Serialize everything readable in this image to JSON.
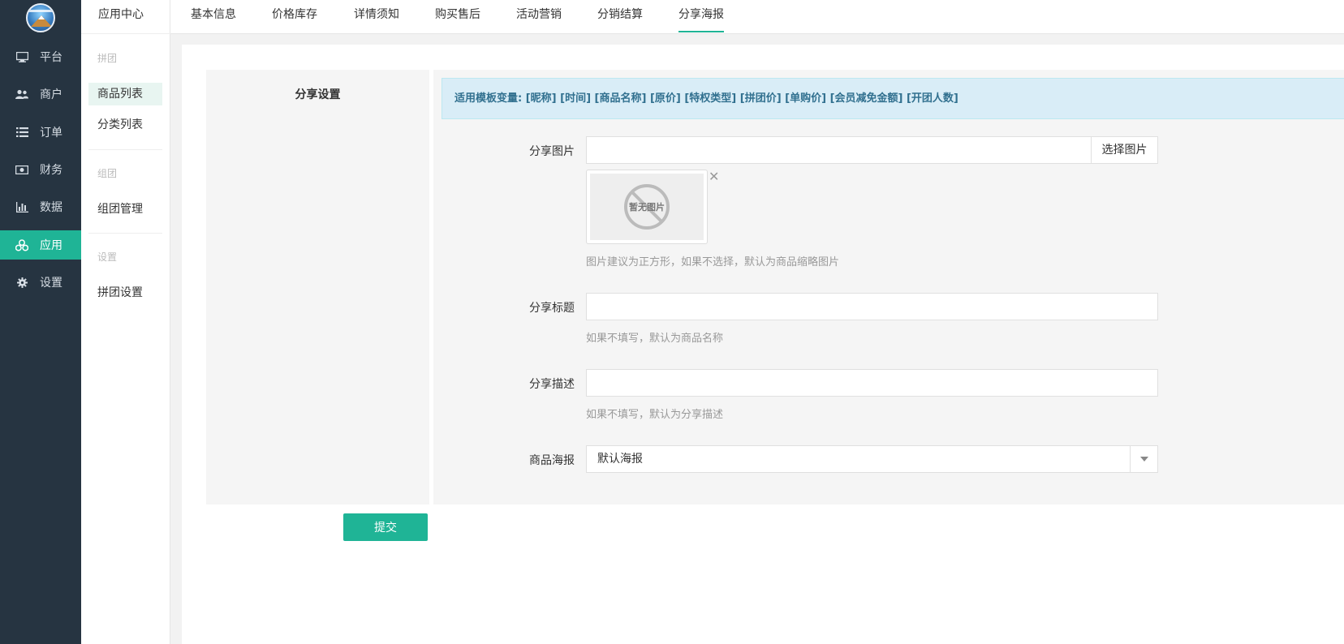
{
  "sidebar": {
    "items": [
      {
        "label": "平台",
        "icon": "monitor-icon"
      },
      {
        "label": "商户",
        "icon": "users-icon"
      },
      {
        "label": "订单",
        "icon": "list-icon"
      },
      {
        "label": "财务",
        "icon": "money-icon"
      },
      {
        "label": "数据",
        "icon": "bar-chart-icon"
      },
      {
        "label": "应用",
        "icon": "apps-icon",
        "active": true
      },
      {
        "label": "设置",
        "icon": "gear-icon"
      }
    ],
    "active_color": "#1fb496",
    "bg_color": "#263441"
  },
  "subnav": {
    "header": "应用中心",
    "groups": [
      {
        "title": "拼团",
        "items": [
          "商品列表",
          "分类列表"
        ]
      },
      {
        "title": "组团",
        "items": [
          "组团管理"
        ]
      },
      {
        "title": "设置",
        "items": [
          "拼团设置"
        ]
      }
    ]
  },
  "tabs": [
    "基本信息",
    "价格库存",
    "详情须知",
    "购买售后",
    "活动营销",
    "分销结算",
    "分享海报"
  ],
  "active_tab": "分享海报",
  "section_title": "分享设置",
  "alert": "适用模板变量: [昵称] [时间] [商品名称] [原价] [特权类型] [拼团价] [单购价] [会员减免金额] [开团人数]",
  "form": {
    "share_image": {
      "label": "分享图片",
      "value": "",
      "button": "选择图片",
      "placeholder_text": "暂无图片",
      "hint": "图片建议为正方形，如果不选择，默认为商品缩略图片"
    },
    "share_title": {
      "label": "分享标题",
      "value": "",
      "hint": "如果不填写，默认为商品名称"
    },
    "share_desc": {
      "label": "分享描述",
      "value": "",
      "hint": "如果不填写，默认为分享描述"
    },
    "poster": {
      "label": "商品海报",
      "selected": "默认海报"
    }
  },
  "submit_label": "提交"
}
